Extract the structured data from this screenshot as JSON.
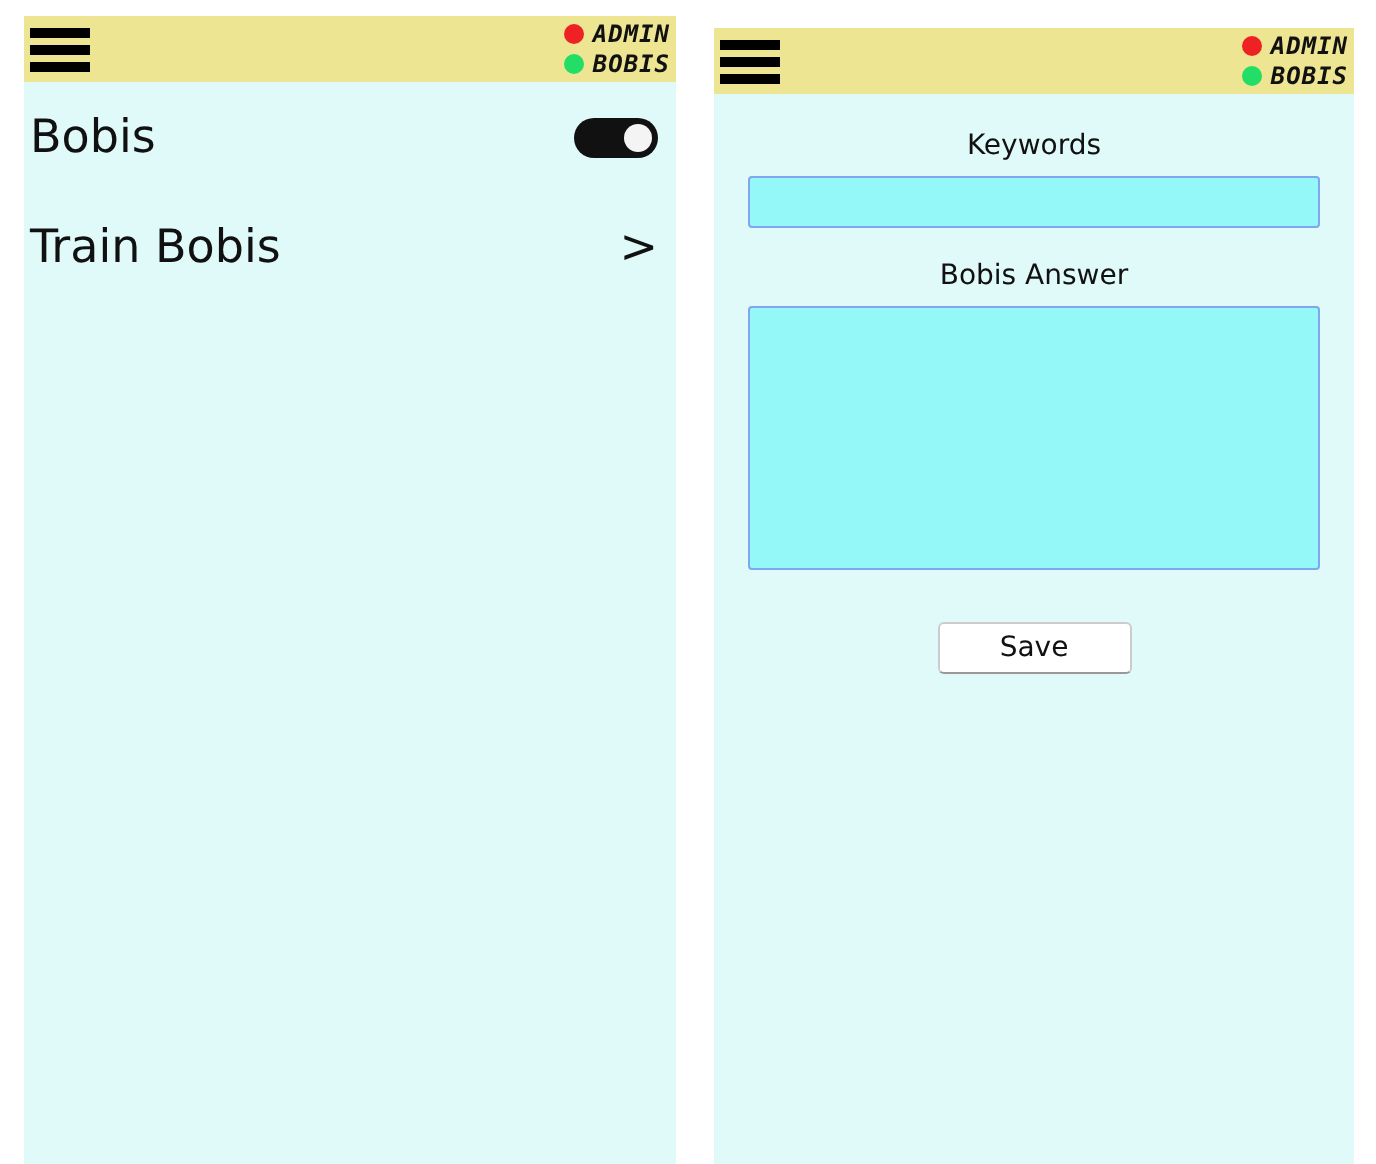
{
  "screens": [
    {
      "kind": "settings",
      "header": {
        "statuses": [
          {
            "label": "ADMIN",
            "color": "#ee2222"
          },
          {
            "label": "BOBIS",
            "color": "#22dd66"
          }
        ]
      },
      "rows": [
        {
          "kind": "toggle",
          "label": "Bobis",
          "on": true
        },
        {
          "kind": "link",
          "label": "Train Bobis",
          "chevron": ">"
        }
      ]
    },
    {
      "kind": "form",
      "header": {
        "statuses": [
          {
            "label": "ADMIN",
            "color": "#ee2222"
          },
          {
            "label": "BOBIS",
            "color": "#22dd66"
          }
        ]
      },
      "fields": [
        {
          "kind": "line",
          "label": "Keywords"
        },
        {
          "kind": "area",
          "label": "Bobis Answer"
        }
      ],
      "button": "Save"
    }
  ]
}
